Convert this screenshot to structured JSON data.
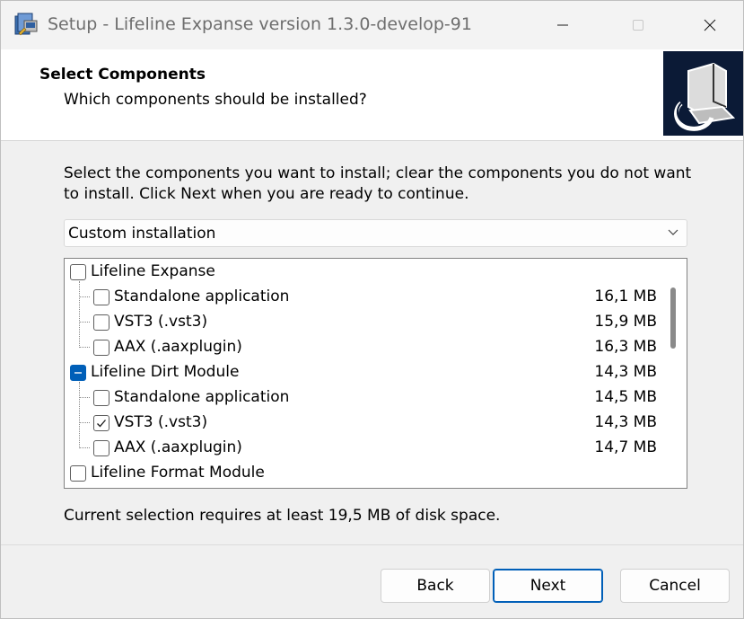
{
  "window": {
    "title": "Setup - Lifeline Expanse version 1.3.0-develop-91",
    "controls": [
      "minimize-icon",
      "maximize-icon",
      "close-icon"
    ]
  },
  "header": {
    "title": "Select Components",
    "subtitle": "Which components should be installed?"
  },
  "main": {
    "instructions": "Select the components you want to install; clear the components you do not want to install. Click Next when you are ready to continue.",
    "install_type": {
      "selected": "Custom installation"
    },
    "components": [
      {
        "label": "Lifeline Expanse",
        "size": "",
        "level": 0,
        "state": "unchecked"
      },
      {
        "label": "Standalone application",
        "size": "16,1 MB",
        "level": 1,
        "state": "unchecked"
      },
      {
        "label": "VST3 (.vst3)",
        "size": "15,9 MB",
        "level": 1,
        "state": "unchecked"
      },
      {
        "label": "AAX (.aaxplugin)",
        "size": "16,3 MB",
        "level": 1,
        "state": "unchecked"
      },
      {
        "label": "Lifeline Dirt Module",
        "size": "14,3 MB",
        "level": 0,
        "state": "partial"
      },
      {
        "label": "Standalone application",
        "size": "14,5 MB",
        "level": 1,
        "state": "unchecked"
      },
      {
        "label": "VST3 (.vst3)",
        "size": "14,3 MB",
        "level": 1,
        "state": "checked"
      },
      {
        "label": "AAX (.aaxplugin)",
        "size": "14,7 MB",
        "level": 1,
        "state": "unchecked"
      },
      {
        "label": "Lifeline Format Module",
        "size": "",
        "level": 0,
        "state": "unchecked"
      }
    ],
    "disk_space": "Current selection requires at least 19,5 MB of disk space."
  },
  "footer": {
    "back_label": "Back",
    "next_label": "Next",
    "cancel_label": "Cancel"
  },
  "colors": {
    "accent": "#005fb8",
    "wizard_image_bg": "#0b1a36"
  }
}
